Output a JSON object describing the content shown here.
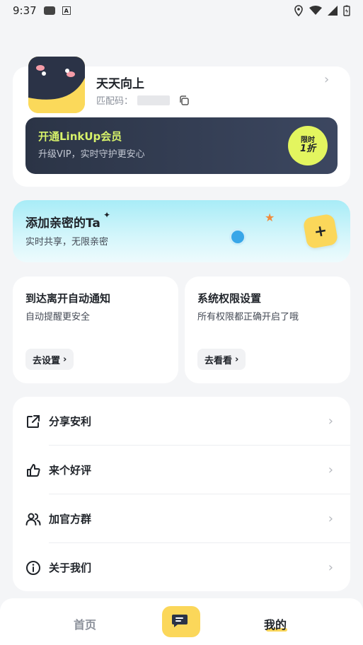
{
  "status_bar": {
    "time": "9:37"
  },
  "profile": {
    "nickname": "天天向上",
    "code_label": "匹配码：",
    "vip": {
      "title": "开通LinkUp会员",
      "subtitle": "升级VIP，实时守护更安心",
      "badge_line1": "限时",
      "badge_line2": "1折"
    }
  },
  "partner": {
    "title": "添加亲密的Ta",
    "subtitle": "实时共享，无限亲密"
  },
  "auto_notify": {
    "title": "到达离开自动通知",
    "subtitle": "自动提醒更安全",
    "button": "去设置"
  },
  "permissions": {
    "title": "系统权限设置",
    "subtitle": "所有权限都正确开启了哦",
    "button": "去看看"
  },
  "menu": [
    {
      "label": "分享安利",
      "icon": "share-icon"
    },
    {
      "label": "来个好评",
      "icon": "thumbs-up-icon"
    },
    {
      "label": "加官方群",
      "icon": "group-icon"
    },
    {
      "label": "关于我们",
      "icon": "info-icon"
    }
  ],
  "bottom_nav": {
    "home": "首页",
    "mine": "我的"
  },
  "colors": {
    "accent_yellow": "#fbd75a",
    "vip_green": "#d7f26a",
    "banner_dark": "#2b3446",
    "partner_cyan": "#a8ecf7"
  }
}
